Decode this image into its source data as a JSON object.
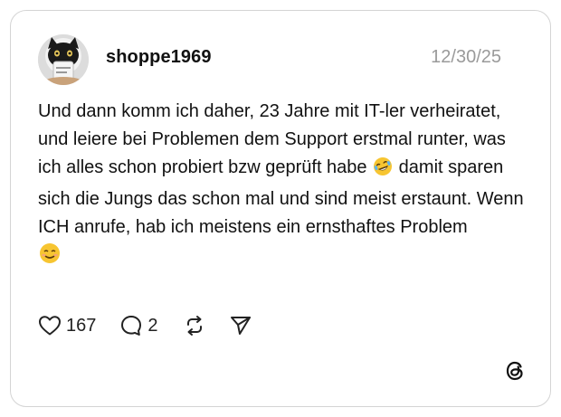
{
  "post": {
    "username": "shoppe1969",
    "date": "12/30/25",
    "text_part1": "Und dann komm ich daher, 23 Jahre mit IT-ler verheiratet, und leiere bei Problemen dem Support erstmal runter, was ich alles schon probiert bzw geprüft habe",
    "text_part2": "damit sparen sich die Jungs das schon mal und sind meist erstaunt. Wenn ICH anrufe, hab ich meistens ein ernsthaftes Problem",
    "emoji_1": "rolling-on-floor-laughing",
    "emoji_2": "smiling-face"
  },
  "actions": {
    "like_count": "167",
    "reply_count": "2",
    "like_icon": "heart-icon",
    "reply_icon": "speech-bubble-icon",
    "repost_icon": "repost-icon",
    "share_icon": "send-icon"
  },
  "branding": {
    "logo": "threads-logo-icon"
  }
}
